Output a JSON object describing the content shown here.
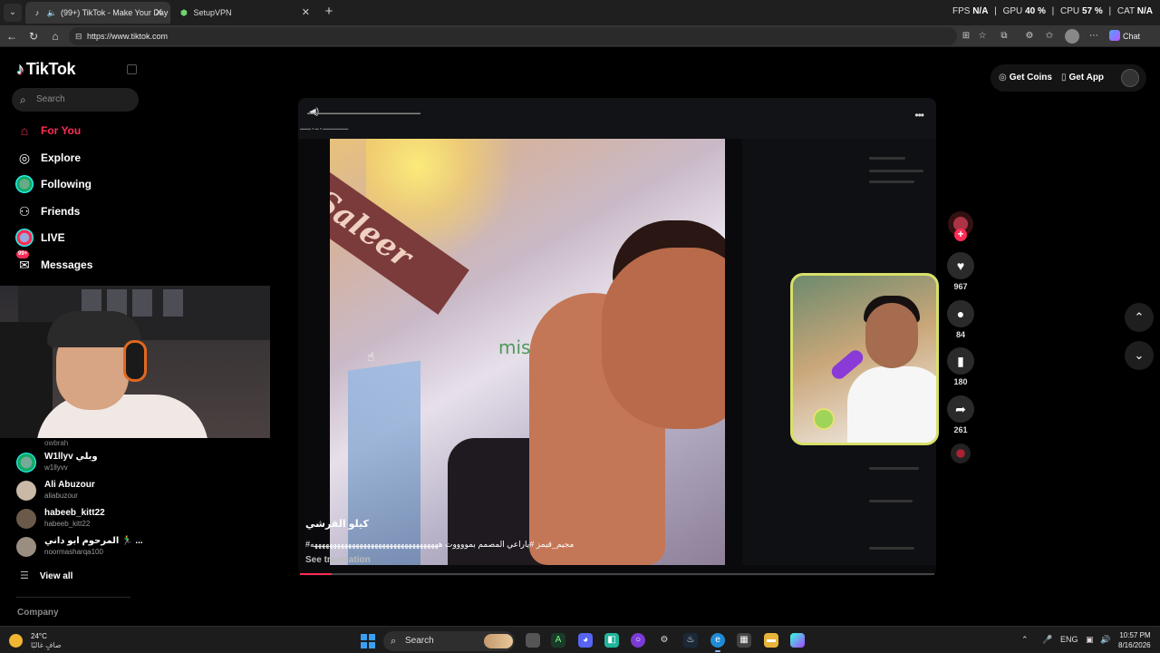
{
  "browser": {
    "tabs": [
      {
        "label": "(99+) TikTok - Make Your Day",
        "favicon": "tiktok-icon",
        "active": true
      },
      {
        "label": "SetupVPN",
        "favicon": "vpn-icon",
        "active": false
      }
    ],
    "perf": {
      "fps_label": "FPS",
      "fps": "N/A",
      "gpu_label": "GPU",
      "gpu": "40 %",
      "cpu_label": "CPU",
      "cpu": "57 %",
      "cat_label": "CAT",
      "cat": "N/A"
    },
    "url": "https://www.tiktok.com",
    "chat_label": "Chat"
  },
  "sidebar": {
    "logo": "TikTok",
    "search_placeholder": "Search",
    "nav": [
      {
        "label": "For You",
        "icon": "home-icon",
        "active": true
      },
      {
        "label": "Explore",
        "icon": "compass-icon"
      },
      {
        "label": "Following",
        "icon": "following-avatar-icon"
      },
      {
        "label": "Friends",
        "icon": "friends-icon"
      },
      {
        "label": "LIVE",
        "icon": "live-icon"
      },
      {
        "label": "Messages",
        "icon": "messages-icon",
        "badge": "99+"
      }
    ],
    "accounts_overflow": "owbrah",
    "accounts": [
      {
        "name": "W1llyv وبلي",
        "handle": "w1llyvv"
      },
      {
        "name": "Ali Abuzour",
        "handle": "aliabuzour"
      },
      {
        "name": "habeeb_kitt22",
        "handle": "habeeb_kitt22"
      },
      {
        "name": "المرحوم ابو داني 🏃‍♂️ ...",
        "handle": "noormasharqa100"
      }
    ],
    "view_all": "View all",
    "company": "Company"
  },
  "header": {
    "get_coins": "Get Coins",
    "get_app": "Get App"
  },
  "video": {
    "author": "كيلو القرشي",
    "caption": "#مجيم_قيمز #ياراعي المصمم بمووووت ههههههههههههههههههههههههههههههههههه",
    "see_translation": "See translation",
    "overlay_text": "mis",
    "sign_text": "Saleer",
    "progress": 0.05
  },
  "actions": {
    "likes": "967",
    "comments": "84",
    "saves": "180",
    "shares": "261"
  },
  "taskbar": {
    "temp": "24°C",
    "weather_desc": "صافٍ غالبًا",
    "search": "Search",
    "lang": "ENG",
    "time": "10:57 PM",
    "date": "8/16/2026"
  }
}
